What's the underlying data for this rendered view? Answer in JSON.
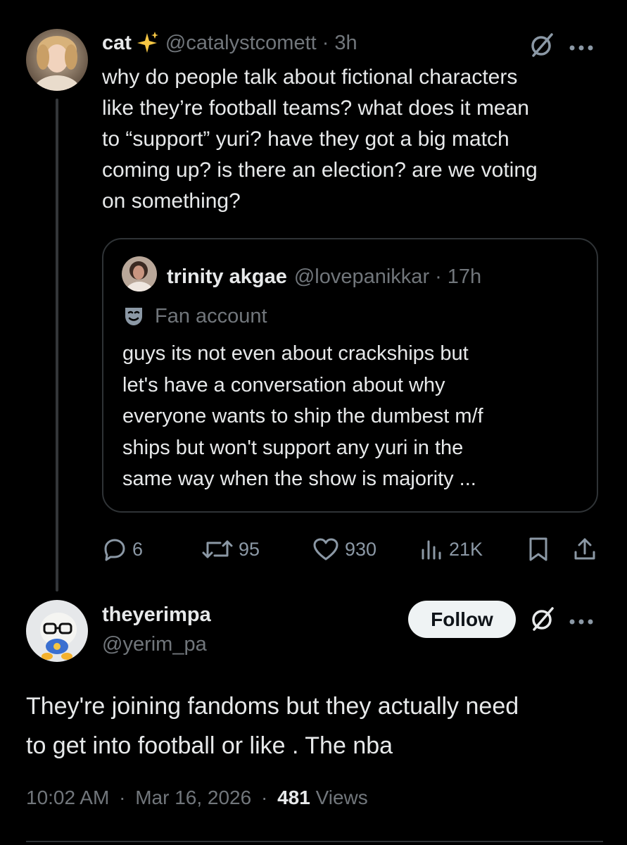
{
  "parent": {
    "name": "cat",
    "handle": "@catalystcomett",
    "sep": "·",
    "time": "3h",
    "lines": [
      "why do people talk about fictional characters",
      "like they’re football  teams? what does it mean",
      "to “support” yuri? have they got a big match",
      "coming up? is there an election? are we voting",
      "on something?"
    ]
  },
  "quote": {
    "name": "trinity akgae",
    "handle": "@lovepanikkar",
    "sep": "·",
    "time": "17h",
    "label": "Fan account",
    "lines": [
      "guys its not even about crackships but",
      "let's have a conversation about why",
      "everyone wants to ship the dumbest m/f",
      "ships but won't support any yuri in the",
      "same way when the show is majority ..."
    ]
  },
  "actions": {
    "replies": "6",
    "reposts": "95",
    "likes": "930",
    "views": "21K"
  },
  "reply": {
    "name": "theyerimpa",
    "handle": "@yerim_pa",
    "follow_label": "Follow",
    "lines": [
      "They're joining fandoms but they actually need",
      "to get into football or like . The nba"
    ],
    "time": "10:02 AM",
    "sep1": "·",
    "date": "Mar 16, 2026",
    "sep2": "·",
    "views_count": "481",
    "views_label": "Views"
  },
  "colors": {
    "background": "#000000",
    "text": "#e7e9ea",
    "muted": "#71767b",
    "sparkle": "#f6c744",
    "border": "#2f3336"
  },
  "icons": {
    "grok": "grok-icon",
    "more": "more-icon",
    "reply": "reply-icon",
    "repost": "repost-icon",
    "like": "heart-icon",
    "views": "views-icon",
    "bookmark": "bookmark-icon",
    "share": "share-icon",
    "label": "mask-icon"
  }
}
